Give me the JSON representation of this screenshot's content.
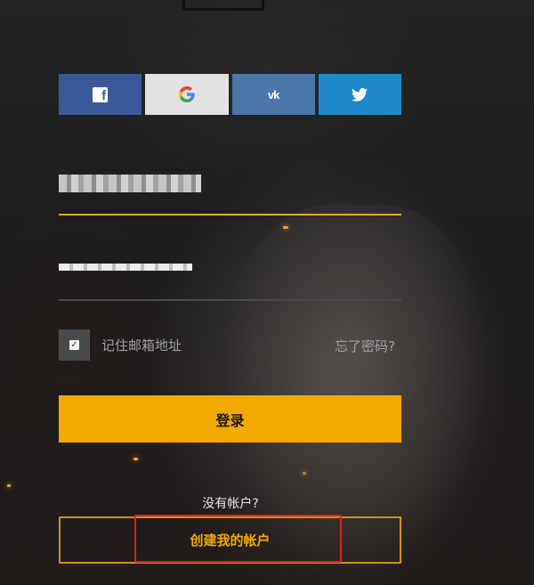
{
  "social": {
    "facebook_icon": "facebook-icon",
    "google_icon": "google-icon",
    "vk_icon": "vk-icon",
    "twitter_icon": "twitter-icon",
    "colors": {
      "facebook": "#3b5998",
      "google": "#e2e2e2",
      "vk": "#4a76a8",
      "twitter": "#1f88c8"
    }
  },
  "form": {
    "remember_label": "记住邮箱地址",
    "forgot_label": "忘了密码?",
    "login_label": "登录",
    "no_account_text": "没有帐户?",
    "create_account_label": "创建我的帐户"
  },
  "colors": {
    "accent": "#f2a900",
    "highlight": "#e0201c"
  }
}
